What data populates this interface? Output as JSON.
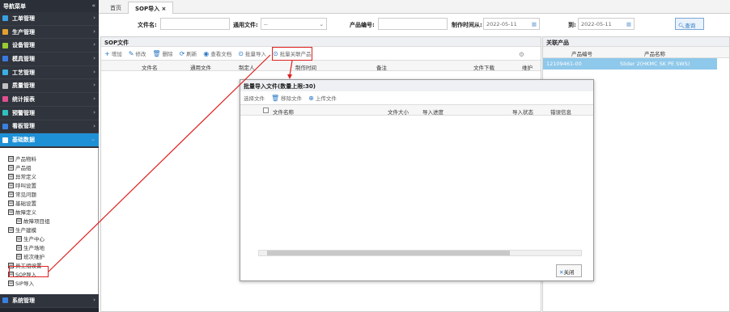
{
  "sidebar": {
    "title": "导航菜单",
    "collapse": "«",
    "menus": [
      {
        "label": "工单管理",
        "color": "#3aa0e0"
      },
      {
        "label": "生产管理",
        "color": "#e0a030"
      },
      {
        "label": "设备管理",
        "color": "#9acd32"
      },
      {
        "label": "模具管理",
        "color": "#3a7ae0"
      },
      {
        "label": "工艺管理",
        "color": "#3ab0e0"
      },
      {
        "label": "质量管理",
        "color": "#c0c0c0"
      },
      {
        "label": "统计报表",
        "color": "#e05090"
      },
      {
        "label": "预警管理",
        "color": "#30c0c0"
      },
      {
        "label": "看板管理",
        "color": "#3a80e0"
      },
      {
        "label": "基础数据",
        "color": "#ffffff"
      }
    ],
    "tree": [
      "产品物料",
      "产品组",
      "异常定义",
      "呼叫设置",
      "常见问题",
      "基础设置",
      "故障定义",
      "故障项目组",
      "生产建模",
      "生产中心",
      "生产场地",
      "班次维护",
      "员工组设置",
      "SOP导入",
      "SIP导入"
    ],
    "bottom": "系统管理"
  },
  "tabs": {
    "home": "首页",
    "sop": "SOP导入 ×"
  },
  "filter": {
    "file_name_label": "文件名:",
    "common_label": "通用文件:",
    "common_value": "--",
    "product_label": "产品编号:",
    "time_label": "制作时间从:",
    "time_from": "2022-05-11",
    "to_label": "到:",
    "time_to": "2022-05-11",
    "query": "查询"
  },
  "sop": {
    "title": "SOP文件",
    "toolbar": [
      "增加",
      "修改",
      "删除",
      "刷新",
      "查看文档",
      "批量导入",
      "批量关联产品"
    ],
    "cols": [
      "文件名",
      "通用文件",
      "制定人",
      "制作时间",
      "备注",
      "文件下载",
      "维护"
    ]
  },
  "related": {
    "title": "关联产品",
    "cols": [
      "产品编号",
      "产品名称"
    ],
    "row": [
      "12109461-00",
      "Slider 2(HKMC SK PE SWS)"
    ]
  },
  "modal": {
    "title": "批量导入文件(数量上限:30)",
    "buttons": [
      "选择文件",
      "移除文件",
      "上传文件"
    ],
    "cols": [
      "文件名称",
      "文件大小",
      "导入进度",
      "导入状态",
      "错误信息"
    ],
    "close": "关闭"
  }
}
